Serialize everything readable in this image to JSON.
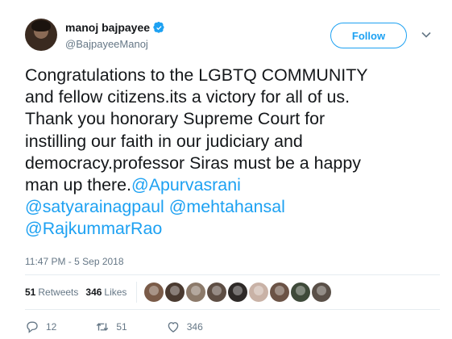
{
  "user": {
    "display_name": "manoj bajpayee",
    "handle": "@BajpayeeManoj",
    "verified": true
  },
  "follow_button": {
    "label": "Follow"
  },
  "tweet": {
    "lines": [
      {
        "text": "Congratulations to the LGBTQ COMMUNITY"
      },
      {
        "text": "and fellow citizens.its a victory for all of us."
      },
      {
        "text": "Thank you honorary Supreme Court for"
      },
      {
        "text": "instilling our faith in our judiciary and"
      },
      {
        "text": "democracy.professor Siras must be a happy"
      },
      {
        "text": "man up there.",
        "mention": "@Apurvasrani"
      }
    ],
    "mentions_line": [
      "@satyarainagpaul",
      "@mehtahansal"
    ],
    "mentions_last": "@RajkummarRao"
  },
  "timestamp": "11:47 PM - 5 Sep 2018",
  "stats": {
    "retweets_count": "51",
    "retweets_label": "Retweets",
    "likes_count": "346",
    "likes_label": "Likes"
  },
  "likers": [
    "#7a5b48",
    "#4a3a30",
    "#8c7a6a",
    "#5e4e44",
    "#2e2a28",
    "#c9b2a6",
    "#6b5346",
    "#3f4a3a",
    "#5a5048"
  ],
  "actions": {
    "reply_count": "12",
    "retweet_count": "51",
    "like_count": "346"
  },
  "colors": {
    "accent": "#1da1f2",
    "text": "#14171a",
    "secondary": "#657786"
  }
}
